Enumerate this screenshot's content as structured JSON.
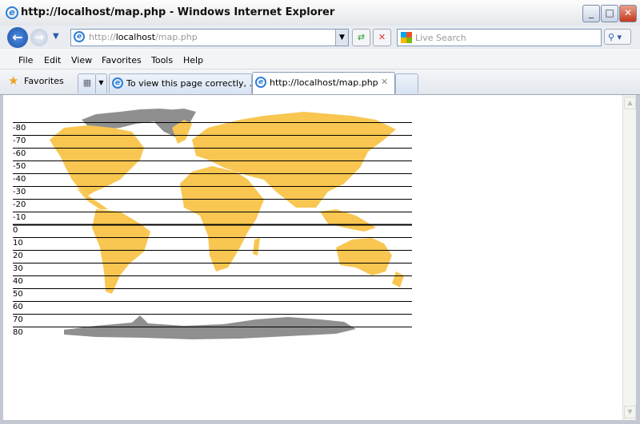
{
  "window": {
    "title": "http://localhost/map.php - Windows Internet Explorer"
  },
  "nav": {
    "address_prefix": "http://",
    "address_host": "localhost",
    "address_path": "/map.php",
    "search_placeholder": "Live Search"
  },
  "menu": [
    "File",
    "Edit",
    "View",
    "Favorites",
    "Tools",
    "Help"
  ],
  "favorites": {
    "label": "Favorites"
  },
  "tabs": [
    {
      "label": "To view this page correctly, ..."
    },
    {
      "label": "http://localhost/map.php",
      "active": true
    }
  ],
  "map": {
    "land_color": "#f8c651",
    "ice_color": "#8f8f8f",
    "latitude_labels": [
      "-80",
      "-70",
      "-60",
      "-50",
      "-40",
      "-30",
      "-20",
      "-10",
      "0",
      "10",
      "20",
      "30",
      "40",
      "50",
      "60",
      "70",
      "80"
    ]
  }
}
